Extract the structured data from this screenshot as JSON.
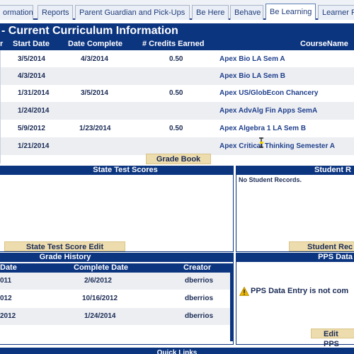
{
  "tabs": [
    "ormation",
    "Reports",
    "Parent Guardian and Pick-Ups",
    "Be Here",
    "Behave",
    "Be Learning",
    "Learner P"
  ],
  "curriculum": {
    "title": "- Current Curriculum Information",
    "columns": [
      "r",
      "Start Date",
      "Date Complete",
      "# Credits Earned",
      "CourseName"
    ],
    "rows": [
      {
        "start": "3/5/2014",
        "complete": "4/3/2014",
        "credits": "0.50",
        "course": "Apex Bio LA Sem A"
      },
      {
        "start": "4/3/2014",
        "complete": "",
        "credits": "",
        "course": "Apex Bio LA Sem B"
      },
      {
        "start": "1/31/2014",
        "complete": "3/5/2014",
        "credits": "0.50",
        "course": "Apex US/GlobEcon Chancery"
      },
      {
        "start": "1/24/2014",
        "complete": "",
        "credits": "",
        "course": "Apex AdvAlg Fin Apps SemA"
      },
      {
        "start": "5/9/2012",
        "complete": "1/23/2014",
        "credits": "0.50",
        "course": "Apex Algebra 1 LA Sem B"
      },
      {
        "start": "1/21/2014",
        "complete": "",
        "credits": "",
        "course": "Apex Critical Thinking Semester A"
      }
    ],
    "grade_book_label": "Grade Book"
  },
  "state_test": {
    "title": "State Test Scores",
    "edit_label": "State Test Score Edit"
  },
  "student_records": {
    "title": "Student R",
    "empty_text": "No Student Records.",
    "button_label": "Student Rec"
  },
  "grade_history": {
    "title": "Grade History",
    "columns": [
      "Date",
      "Complete Date",
      "Creator"
    ],
    "rows": [
      {
        "date": "011",
        "complete": "2/6/2012",
        "creator": "dberrios"
      },
      {
        "date": "012",
        "complete": "10/16/2012",
        "creator": "dberrios"
      },
      {
        "date": "2012",
        "complete": "1/24/2014",
        "creator": "dberrios"
      }
    ]
  },
  "pps": {
    "title": "PPS Data",
    "warning_text": "PPS Data Entry is not com",
    "edit_label": "Edit PPS",
    "warning_icon": "warning-icon",
    "warning_color": "#e8b400"
  },
  "quick_links": {
    "title": "Quick Links"
  }
}
